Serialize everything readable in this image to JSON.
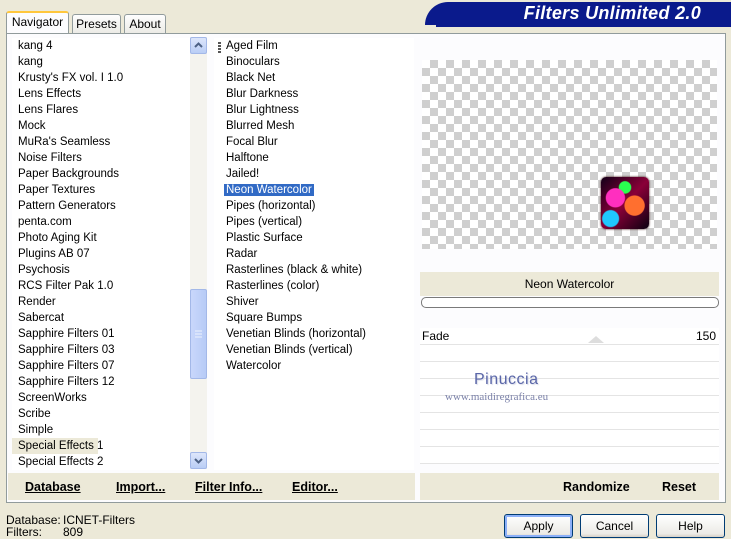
{
  "app_title": "Filters Unlimited 2.0",
  "tabs": [
    {
      "label": "Navigator",
      "active": true
    },
    {
      "label": "Presets",
      "active": false
    },
    {
      "label": "About",
      "active": false
    }
  ],
  "categories": {
    "items": [
      "kang 4",
      "kang",
      "Krusty's FX vol. I 1.0",
      "Lens Effects",
      "Lens Flares",
      "Mock",
      "MuRa's Seamless",
      "Noise Filters",
      "Paper Backgrounds",
      "Paper Textures",
      "Pattern Generators",
      "penta.com",
      "Photo Aging Kit",
      "Plugins AB 07",
      "Psychosis",
      "RCS Filter Pak 1.0",
      "Render",
      "Sabercat",
      "Sapphire Filters 01",
      "Sapphire Filters 03",
      "Sapphire Filters 07",
      "Sapphire Filters 12",
      "ScreenWorks",
      "Scribe",
      "Simple",
      "Special Effects 1",
      "Special Effects 2"
    ],
    "selected": "Special Effects 1"
  },
  "filters": {
    "items": [
      "Aged Film",
      "Binoculars",
      "Black Net",
      "Blur Darkness",
      "Blur Lightness",
      "Blurred Mesh",
      "Focal Blur",
      "Halftone",
      "Jailed!",
      "Neon Watercolor",
      "Pipes (horizontal)",
      "Pipes (vertical)",
      "Plastic Surface",
      "Radar",
      "Rasterlines (black & white)",
      "Rasterlines (color)",
      "Shiver",
      "Square Bumps",
      "Venetian Blinds (horizontal)",
      "Venetian Blinds (vertical)",
      "Watercolor"
    ],
    "selected": "Neon Watercolor"
  },
  "preview": {
    "filter_name": "Neon Watercolor"
  },
  "params": [
    {
      "label": "Fade",
      "value": "150"
    }
  ],
  "watermark": {
    "line1": "Pinuccia",
    "line2": "www.maidiregrafica.eu"
  },
  "toolbar": {
    "database": "Database",
    "import": "Import...",
    "filter_info": "Filter Info...",
    "editor": "Editor...",
    "randomize": "Randomize",
    "reset": "Reset"
  },
  "footer": {
    "database_label": "Database:",
    "database_value": "ICNET-Filters",
    "filters_label": "Filters:",
    "filters_value": "809"
  },
  "buttons": {
    "apply": "Apply",
    "cancel": "Cancel",
    "help": "Help"
  },
  "colors": {
    "banner": "#0a1a8c",
    "selection": "#316ac5",
    "tab_highlight": "#ffc73c"
  }
}
